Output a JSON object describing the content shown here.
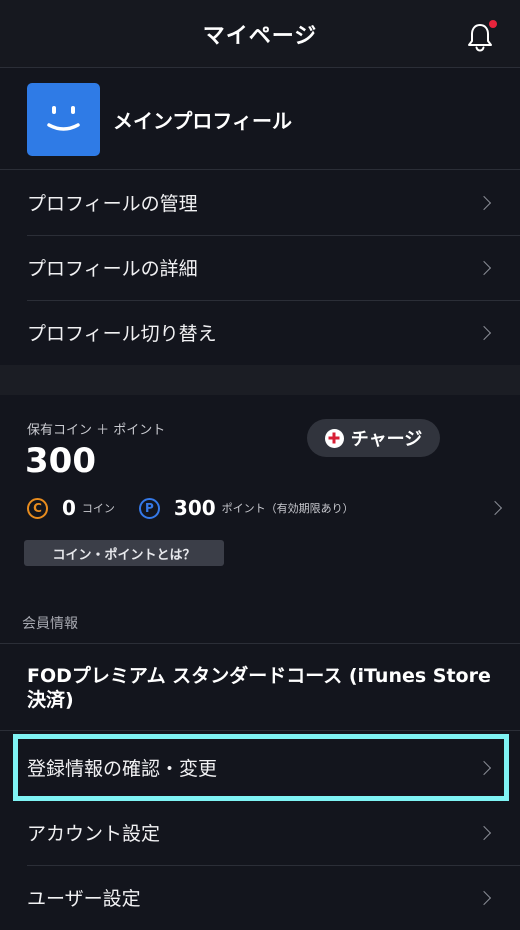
{
  "header": {
    "title": "マイページ",
    "notification_icon": "bell-icon",
    "has_unread": true
  },
  "profile": {
    "name": "メインプロフィール",
    "menu": [
      {
        "label": "プロフィールの管理"
      },
      {
        "label": "プロフィールの詳細"
      },
      {
        "label": "プロフィール切り替え"
      }
    ]
  },
  "coins": {
    "caption": "保有コイン ＋ ポイント",
    "total": "300",
    "charge_label": "チャージ",
    "coin_badge": "C",
    "coin_value": "0",
    "coin_unit": "コイン",
    "point_badge": "P",
    "point_value": "300",
    "point_unit": "ポイント（有効期限あり）",
    "about_label": "コイン・ポイントとは？"
  },
  "member": {
    "section_label": "会員情報",
    "plan": "FODプレミアム スタンダードコース (iTunes Store決済)",
    "menu": [
      {
        "label": "登録情報の確認・変更"
      },
      {
        "label": "アカウント設定"
      },
      {
        "label": "ユーザー設定"
      }
    ]
  },
  "colors": {
    "background": "#13151d",
    "avatar": "#2f7be6",
    "notification_dot": "#e8243c",
    "coin_badge": "#e88c1e",
    "point_badge": "#3579e8",
    "charge_plus": "#d81e34",
    "highlight": "#7ff3f4"
  }
}
